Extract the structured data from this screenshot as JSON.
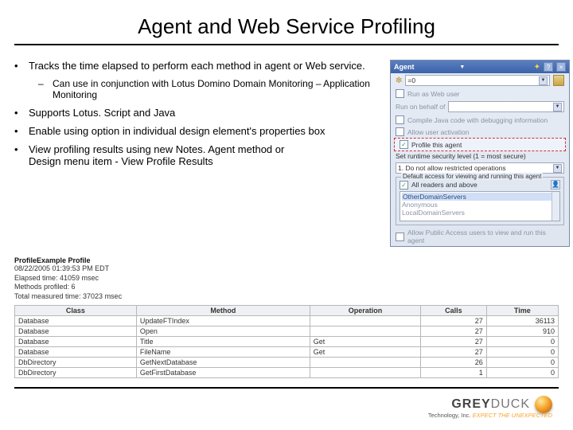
{
  "title": "Agent and Web Service Profiling",
  "bullets": {
    "b1": "Tracks the time elapsed to perform each method in agent or Web service.",
    "b1a": "Can use in conjunction with Lotus Domino Domain Monitoring – Application Monitoring",
    "b2": "Supports Lotus. Script and Java",
    "b3": "Enable using option in individual design element's properties box",
    "b4": "View profiling results using new Notes. Agent method or\nDesign menu item - View Profile Results"
  },
  "panel": {
    "title": "Agent",
    "help": "?",
    "close": "×",
    "row1_label": "",
    "row1_val": "=0",
    "row2_label": "Run as Web user",
    "row3_label": "Run on behalf of",
    "chk1": "Compile Java code with debugging information",
    "chk2": "Allow user activation",
    "chk3": "Profile this agent",
    "sec_label": "Set runtime security level (1 = most secure)",
    "sec_select": "1. Do not allow restricted operations",
    "fs_legend": "Default access for viewing and running this agent",
    "radio1": "All readers and above",
    "list1": "OtherDomainServers",
    "list2": "Anonymous",
    "list3": "LocalDomainServers",
    "chk_public": "Allow Public Access users to view and run this agent"
  },
  "profile": {
    "header": "ProfileExample Profile",
    "meta1": "08/22/2005 01:39:53 PM EDT",
    "meta2": "Elapsed time: 41059 msec",
    "meta3": "Methods profiled: 6",
    "meta4": "Total measured time: 37023 msec",
    "cols": {
      "c1": "Class",
      "c2": "Method",
      "c3": "Operation",
      "c4": "Calls",
      "c5": "Time"
    },
    "rows": [
      {
        "cls": "Database",
        "method": "UpdateFTIndex",
        "op": "",
        "calls": "27",
        "time": "36113"
      },
      {
        "cls": "Database",
        "method": "Open",
        "op": "",
        "calls": "27",
        "time": "910"
      },
      {
        "cls": "Database",
        "method": "Title",
        "op": "Get",
        "calls": "27",
        "time": "0"
      },
      {
        "cls": "Database",
        "method": "FileName",
        "op": "Get",
        "calls": "27",
        "time": "0"
      },
      {
        "cls": "DbDirectory",
        "method": "GetNextDatabase",
        "op": "",
        "calls": "26",
        "time": "0"
      },
      {
        "cls": "DbDirectory",
        "method": "GetFirstDatabase",
        "op": "",
        "calls": "1",
        "time": "0"
      }
    ]
  },
  "logo": {
    "grey": "GREY",
    "duck": "DUCK",
    "sub1": "Technology, Inc.",
    "sub2": "EXPECT THE UNEXPECTED"
  }
}
